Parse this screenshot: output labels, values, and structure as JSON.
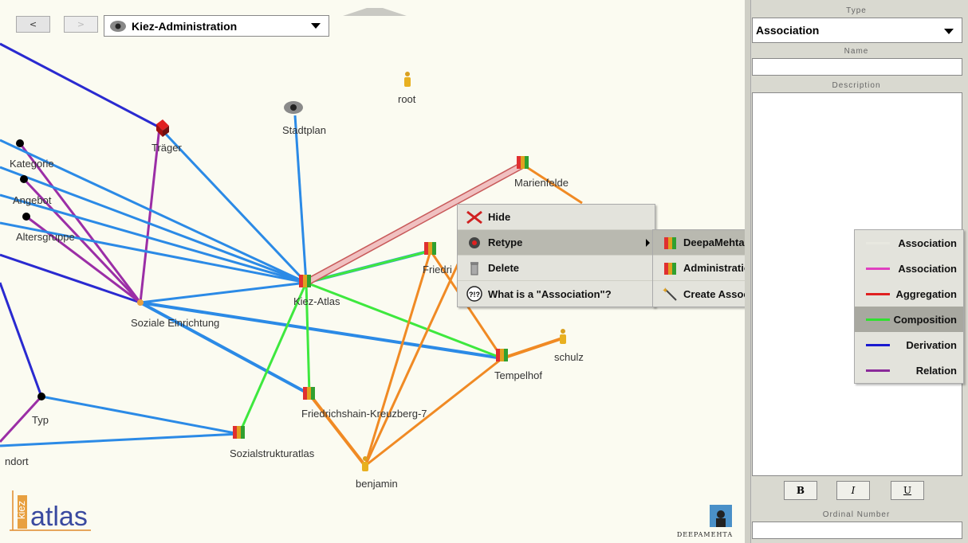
{
  "toolbar": {
    "back_label": "<",
    "forward_label": ">",
    "map_name": "Kiez-Administration"
  },
  "graph": {
    "nodes": [
      {
        "id": "root",
        "label": "root",
        "icon": "user-icon"
      },
      {
        "id": "stadtplan",
        "label": "Stadtplan",
        "icon": "eye-icon"
      },
      {
        "id": "traeger",
        "label": "Träger",
        "icon": "cube-icon"
      },
      {
        "id": "kategorie",
        "label": "Kategorie",
        "icon": "dot-icon"
      },
      {
        "id": "angebot",
        "label": "Angebot",
        "icon": "dot-icon"
      },
      {
        "id": "altersgruppe",
        "label": "Altersgruppe",
        "icon": "dot-icon"
      },
      {
        "id": "soziale",
        "label": "Soziale Einrichtung",
        "icon": "dot-icon"
      },
      {
        "id": "kiez-atlas",
        "label": "Kiez-Atlas",
        "icon": "people-icon"
      },
      {
        "id": "marienfelde",
        "label": "Marienfelde",
        "icon": "people-icon"
      },
      {
        "id": "friedri",
        "label": "Friedri",
        "icon": "people-icon"
      },
      {
        "id": "tempelhof",
        "label": "Tempelhof",
        "icon": "people-icon"
      },
      {
        "id": "schulz",
        "label": "schulz",
        "icon": "user-icon"
      },
      {
        "id": "fk7",
        "label": "Friedrichshain-Kreuzberg-7",
        "icon": "people-icon"
      },
      {
        "id": "sozialstruktur",
        "label": "Sozialstrukturatlas",
        "icon": "people-icon"
      },
      {
        "id": "benjamin",
        "label": "benjamin",
        "icon": "user-icon"
      },
      {
        "id": "typ",
        "label": "Typ",
        "icon": "dot-icon"
      },
      {
        "id": "ndort",
        "label": "ndort",
        "icon": "none"
      }
    ]
  },
  "context_menu": {
    "items": [
      {
        "label": "Hide",
        "icon": "hide-icon"
      },
      {
        "label": "Retype",
        "icon": "retype-icon"
      },
      {
        "label": "Delete",
        "icon": "trash-icon"
      },
      {
        "label": "What is a \"Association\"?",
        "icon": "help-icon"
      }
    ]
  },
  "retype_menu": {
    "items": [
      {
        "label": "DeepaMehta",
        "icon": "people-icon"
      },
      {
        "label": "Administration",
        "icon": "people-icon"
      },
      {
        "label": "Create Association Type ...",
        "icon": "wand-icon"
      }
    ]
  },
  "assoc_menu": {
    "items": [
      {
        "label": "Association",
        "color": "#e8e8e0"
      },
      {
        "label": "Association",
        "color": "#e040c0"
      },
      {
        "label": "Aggregation",
        "color": "#e02020"
      },
      {
        "label": "Composition",
        "color": "#30e030"
      },
      {
        "label": "Derivation",
        "color": "#1a1ad0"
      },
      {
        "label": "Relation",
        "color": "#8a2a9a"
      }
    ]
  },
  "panel": {
    "type_label": "Type",
    "type_value": "Association",
    "name_label": "Name",
    "name_value": "",
    "description_label": "Description",
    "description_value": "",
    "bold_label": "B",
    "italic_label": "I",
    "underline_label": "U",
    "ordinal_label": "Ordinal Number",
    "ordinal_value": ""
  },
  "logos": {
    "kiez_small": "kiez",
    "kiez_big": "atlas",
    "deepamehta": "DEEPAMEHTA"
  },
  "colors": {
    "blue_edge": "#2b8ae6",
    "purple_edge": "#9b2ea6",
    "navy_edge": "#2a2ad0",
    "green_edge": "#3ee83e",
    "orange_edge": "#f08a24",
    "selected_edge": "#e8a0a0"
  }
}
